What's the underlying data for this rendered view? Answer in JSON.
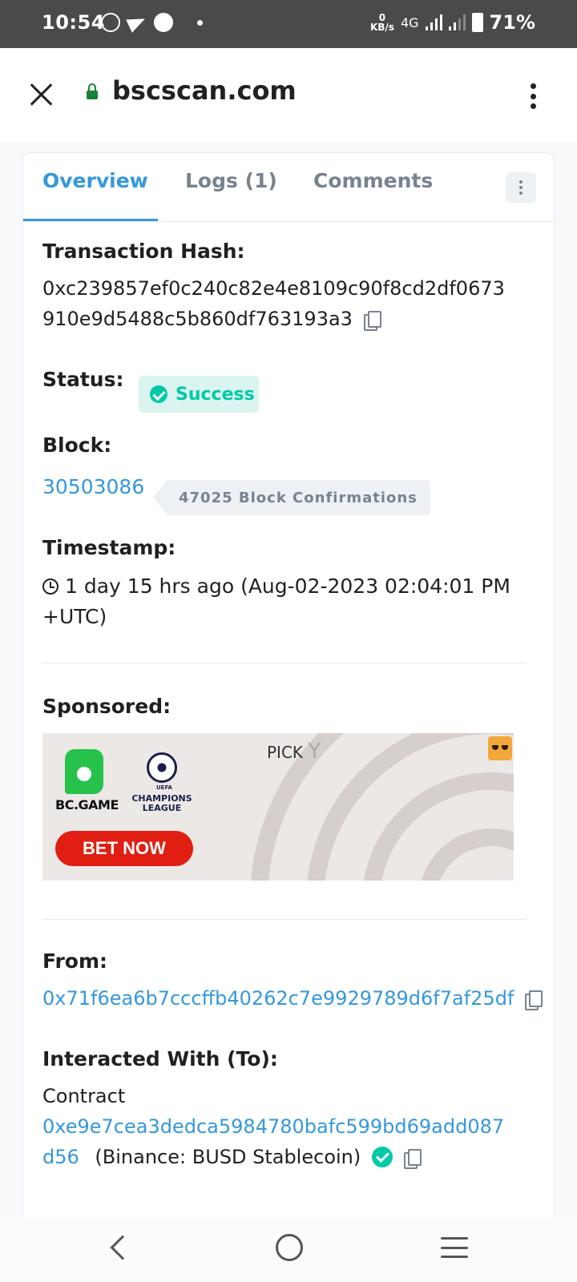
{
  "status_bar": {
    "time": "10:54",
    "kbs_value": "0",
    "kbs_unit": "KB/s",
    "network": "4G",
    "battery": "71%"
  },
  "browser": {
    "url": "bscscan.com"
  },
  "tabs": [
    {
      "label": "Overview",
      "active": true
    },
    {
      "label": "Logs (1)",
      "active": false
    },
    {
      "label": "Comments",
      "active": false
    }
  ],
  "transaction": {
    "hash_label": "Transaction Hash:",
    "hash_line1": "0xc239857ef0c240c82e4e8109c90f8cd2df0673",
    "hash_line2": "910e9d5488c5b860df763193a3",
    "status_label": "Status:",
    "status_value": "Success",
    "block_label": "Block:",
    "block_number": "30503086",
    "block_confirmations": "47025 Block Confirmations",
    "timestamp_label": "Timestamp:",
    "timestamp_line1": "1 day 15 hrs ago (Aug-02-2023 02:04:01 PM",
    "timestamp_line2": "+UTC)",
    "sponsored_label": "Sponsored:",
    "from_label": "From:",
    "from_address": "0x71f6ea6b7cccffb40262c7e9929789d6f7af25df",
    "to_label": "Interacted With (To):",
    "to_type": "Contract",
    "to_address_line1": "0xe9e7cea3dedca5984780bafc599bd69add087",
    "to_address_line2": "d56",
    "to_name": "(Binance: BUSD Stablecoin)"
  },
  "ad": {
    "brand": "BC.GAME",
    "uefa": "UEFA",
    "league": "CHAMPIONS LEAGUE",
    "pick_text": "PICK",
    "pick_letter": "Y",
    "cta": "BET NOW"
  },
  "colors": {
    "link": "#3498db",
    "success": "#00c9a7",
    "ad_button": "#e01f12"
  }
}
